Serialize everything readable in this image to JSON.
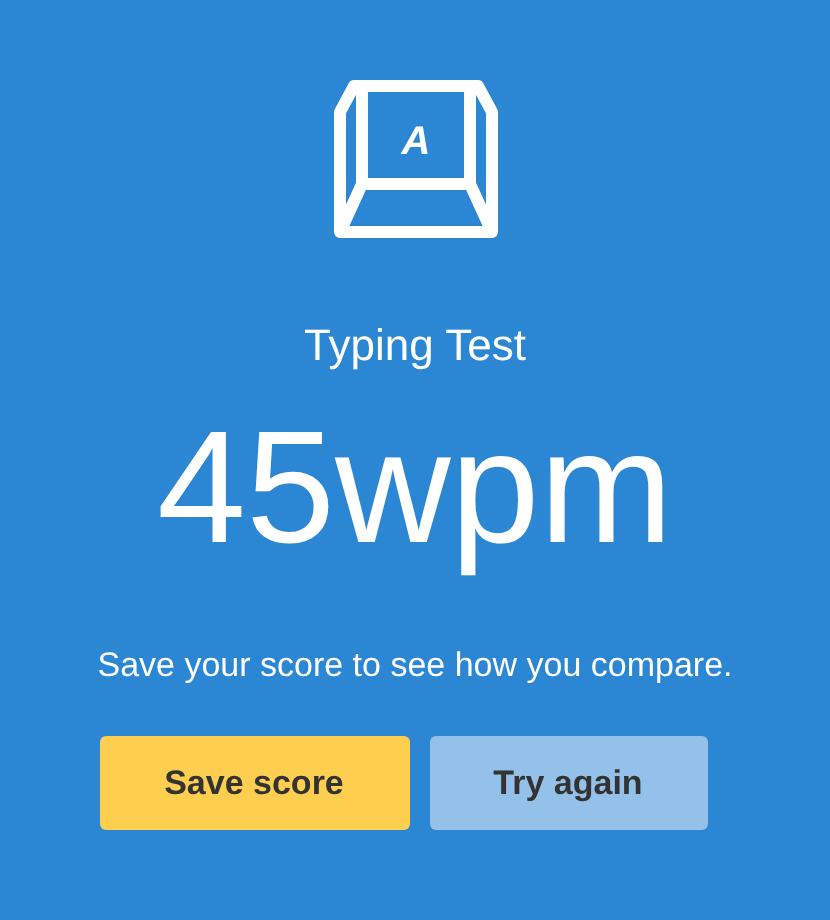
{
  "icon": {
    "key_label": "A"
  },
  "title": "Typing Test",
  "score": "45wpm",
  "message": "Save your score to see how you compare.",
  "buttons": [
    {
      "label": "Save score",
      "kind": "primary"
    },
    {
      "label": "Try again",
      "kind": "secondary"
    }
  ]
}
